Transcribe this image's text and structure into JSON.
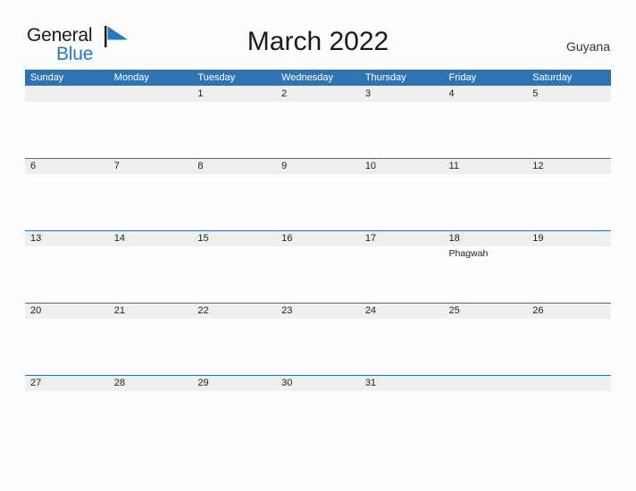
{
  "brand": {
    "line1": "General",
    "line2": "Blue",
    "flag_icon": "blue-triangle-flag-icon",
    "flag_color": "#2079c8"
  },
  "header": {
    "title": "March 2022",
    "country": "Guyana"
  },
  "theme": {
    "header_blue": "#2e74b5",
    "band_gray": "#efefef",
    "page_background": "#fdfdfd",
    "text_color": "#222222",
    "brand_blue": "#2079c8"
  },
  "calendar": {
    "month": "March",
    "year": "2022",
    "weekdays": [
      "Sunday",
      "Monday",
      "Tuesday",
      "Wednesday",
      "Thursday",
      "Friday",
      "Saturday"
    ],
    "weeks": [
      [
        {
          "day": ""
        },
        {
          "day": ""
        },
        {
          "day": "1"
        },
        {
          "day": "2"
        },
        {
          "day": "3"
        },
        {
          "day": "4"
        },
        {
          "day": "5"
        }
      ],
      [
        {
          "day": "6"
        },
        {
          "day": "7"
        },
        {
          "day": "8"
        },
        {
          "day": "9"
        },
        {
          "day": "10"
        },
        {
          "day": "11"
        },
        {
          "day": "12"
        }
      ],
      [
        {
          "day": "13"
        },
        {
          "day": "14"
        },
        {
          "day": "15"
        },
        {
          "day": "16"
        },
        {
          "day": "17"
        },
        {
          "day": "18",
          "event": "Phagwah"
        },
        {
          "day": "19"
        }
      ],
      [
        {
          "day": "20"
        },
        {
          "day": "21"
        },
        {
          "day": "22"
        },
        {
          "day": "23"
        },
        {
          "day": "24"
        },
        {
          "day": "25"
        },
        {
          "day": "26"
        }
      ],
      [
        {
          "day": "27"
        },
        {
          "day": "28"
        },
        {
          "day": "29"
        },
        {
          "day": "30"
        },
        {
          "day": "31"
        },
        {
          "day": ""
        },
        {
          "day": ""
        }
      ]
    ]
  }
}
